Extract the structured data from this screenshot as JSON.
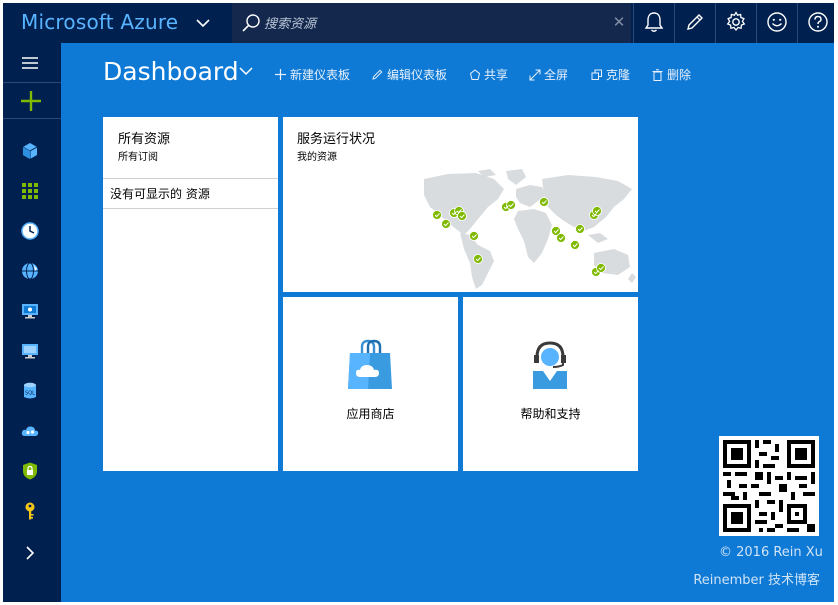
{
  "app": {
    "title": "Microsoft Azure"
  },
  "search": {
    "placeholder": "搜索资源",
    "clear_glyph": "✕"
  },
  "top_icons": [
    "bell-icon",
    "pencil-icon",
    "gear-icon",
    "smiley-icon",
    "help-icon"
  ],
  "left_nav": [
    "hamburger-menu-icon",
    "new-plus-icon",
    "resource-cube-icon",
    "grid-apps-icon",
    "clock-icon",
    "globe-icon",
    "monitor-icon",
    "virtual-machine-icon",
    "sql-database-icon",
    "cloud-services-icon",
    "security-lock-icon",
    "key-icon",
    "expand-chevron-icon"
  ],
  "dashboard": {
    "title": "Dashboard",
    "commands": [
      {
        "label": "新建仪表板",
        "icon": "plus-icon"
      },
      {
        "label": "编辑仪表板",
        "icon": "pencil-icon"
      },
      {
        "label": "共享",
        "icon": "share-icon"
      },
      {
        "label": "全屏",
        "icon": "fullscreen-icon"
      },
      {
        "label": "克隆",
        "icon": "clone-icon"
      },
      {
        "label": "删除",
        "icon": "trash-icon"
      }
    ]
  },
  "tiles": {
    "all_resources": {
      "title": "所有资源",
      "subtitle": "所有订阅",
      "empty": "没有可显示的 资源"
    },
    "service_health": {
      "title": "服务运行状况",
      "subtitle": "我的资源"
    },
    "marketplace": {
      "label": "应用商店"
    },
    "help_support": {
      "label": "帮助和支持"
    }
  },
  "watermark": {
    "copyright": "© 2016 Rein Xu",
    "blog": "Reinember 技术博客"
  },
  "colors": {
    "accent": "#59b4ff",
    "topbar": "#002050",
    "dashboard_bg": "#0f7ad6",
    "status_ok": "#7fba00"
  }
}
